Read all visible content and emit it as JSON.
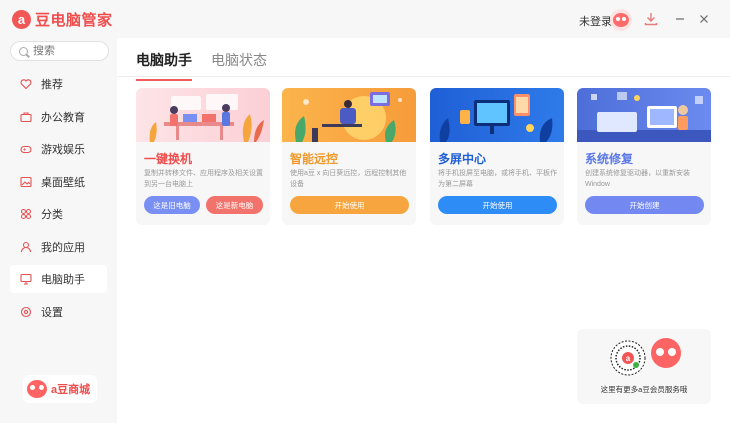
{
  "app": {
    "logo_mark": "a",
    "title": "豆电脑管家",
    "login_text": "未登录",
    "accent": "#f25757"
  },
  "sidebar": {
    "search_placeholder": "搜索",
    "items": [
      {
        "label": "推荐",
        "icon": "heart-icon"
      },
      {
        "label": "办公教育",
        "icon": "briefcase-icon"
      },
      {
        "label": "游戏娱乐",
        "icon": "gamepad-icon"
      },
      {
        "label": "桌面壁纸",
        "icon": "picture-icon"
      },
      {
        "label": "分类",
        "icon": "grid-icon"
      },
      {
        "label": "我的应用",
        "icon": "user-icon"
      },
      {
        "label": "电脑助手",
        "icon": "monitor-icon"
      },
      {
        "label": "设置",
        "icon": "gear-icon"
      }
    ],
    "active_item": "电脑助手",
    "mall_label": "a豆商城"
  },
  "tabs": [
    {
      "label": "电脑助手"
    },
    {
      "label": "电脑状态"
    }
  ],
  "cards": [
    {
      "title": "一键换机",
      "title_color": "#f04d4d",
      "desc": "复制并转移文件、应用程序及相关设置到另一台电脑上",
      "buttons": [
        "这是旧电脑",
        "这是新电脑"
      ],
      "button_colors": [
        "#7a8ff3",
        "#f2736b"
      ]
    },
    {
      "title": "智能远控",
      "title_color": "#f09a2b",
      "desc": "使用a豆 x 向日葵远控，远程控制其他设备",
      "buttons": [
        "开始使用"
      ],
      "button_colors": [
        "#f7a53e"
      ]
    },
    {
      "title": "多屏中心",
      "title_color": "#1f5fd6",
      "desc": "将手机投屏至电脑，或将手机、平板作为第二屏幕",
      "buttons": [
        "开始使用"
      ],
      "button_colors": [
        "#2d8cf5"
      ]
    },
    {
      "title": "系统修复",
      "title_color": "#5b79e8",
      "desc": "创建系统修复驱动器，以重新安装Window",
      "buttons": [
        "开始创建"
      ],
      "button_colors": [
        "#7388f0"
      ]
    }
  ],
  "service": {
    "caption": "这里有更多a豆会员服务哦"
  }
}
